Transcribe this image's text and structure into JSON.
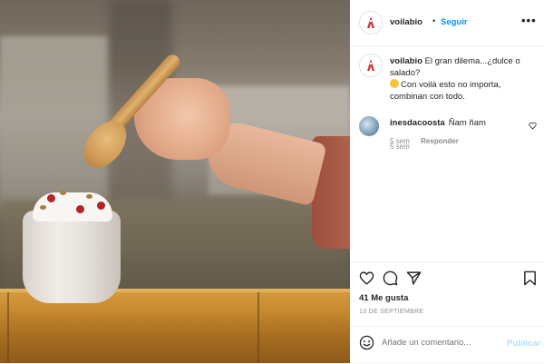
{
  "post": {
    "username": "voilabio",
    "dot": "•",
    "follow_label": "Seguir",
    "more_label": "•••"
  },
  "caption": {
    "username": "voilabio",
    "text_1": "El gran dilema...¿dulce o salado?",
    "text_2": "Con voilà esto no importa, combinan con todo.",
    "time": "5 sem"
  },
  "comments": [
    {
      "username": "inesdacoosta",
      "text": "Ñam ñam",
      "time": "5 sem",
      "reply_label": "Responder"
    }
  ],
  "stats": {
    "likes": "41 Me gusta",
    "date": "13 DE SEPTIEMBRE"
  },
  "comment_box": {
    "placeholder": "Añade un comentario...",
    "publish_label": "Publicar"
  },
  "icons": {
    "avatar": "voila-logo-icon",
    "like": "heart-icon",
    "comment": "comment-icon",
    "share": "send-icon",
    "save": "bookmark-icon",
    "emoji": "smiley-icon"
  },
  "colors": {
    "link": "#0095f6",
    "publish_disabled": "#b2dffc",
    "secondary_text": "#8e8e8e",
    "brand_logo": "#d2373c"
  }
}
